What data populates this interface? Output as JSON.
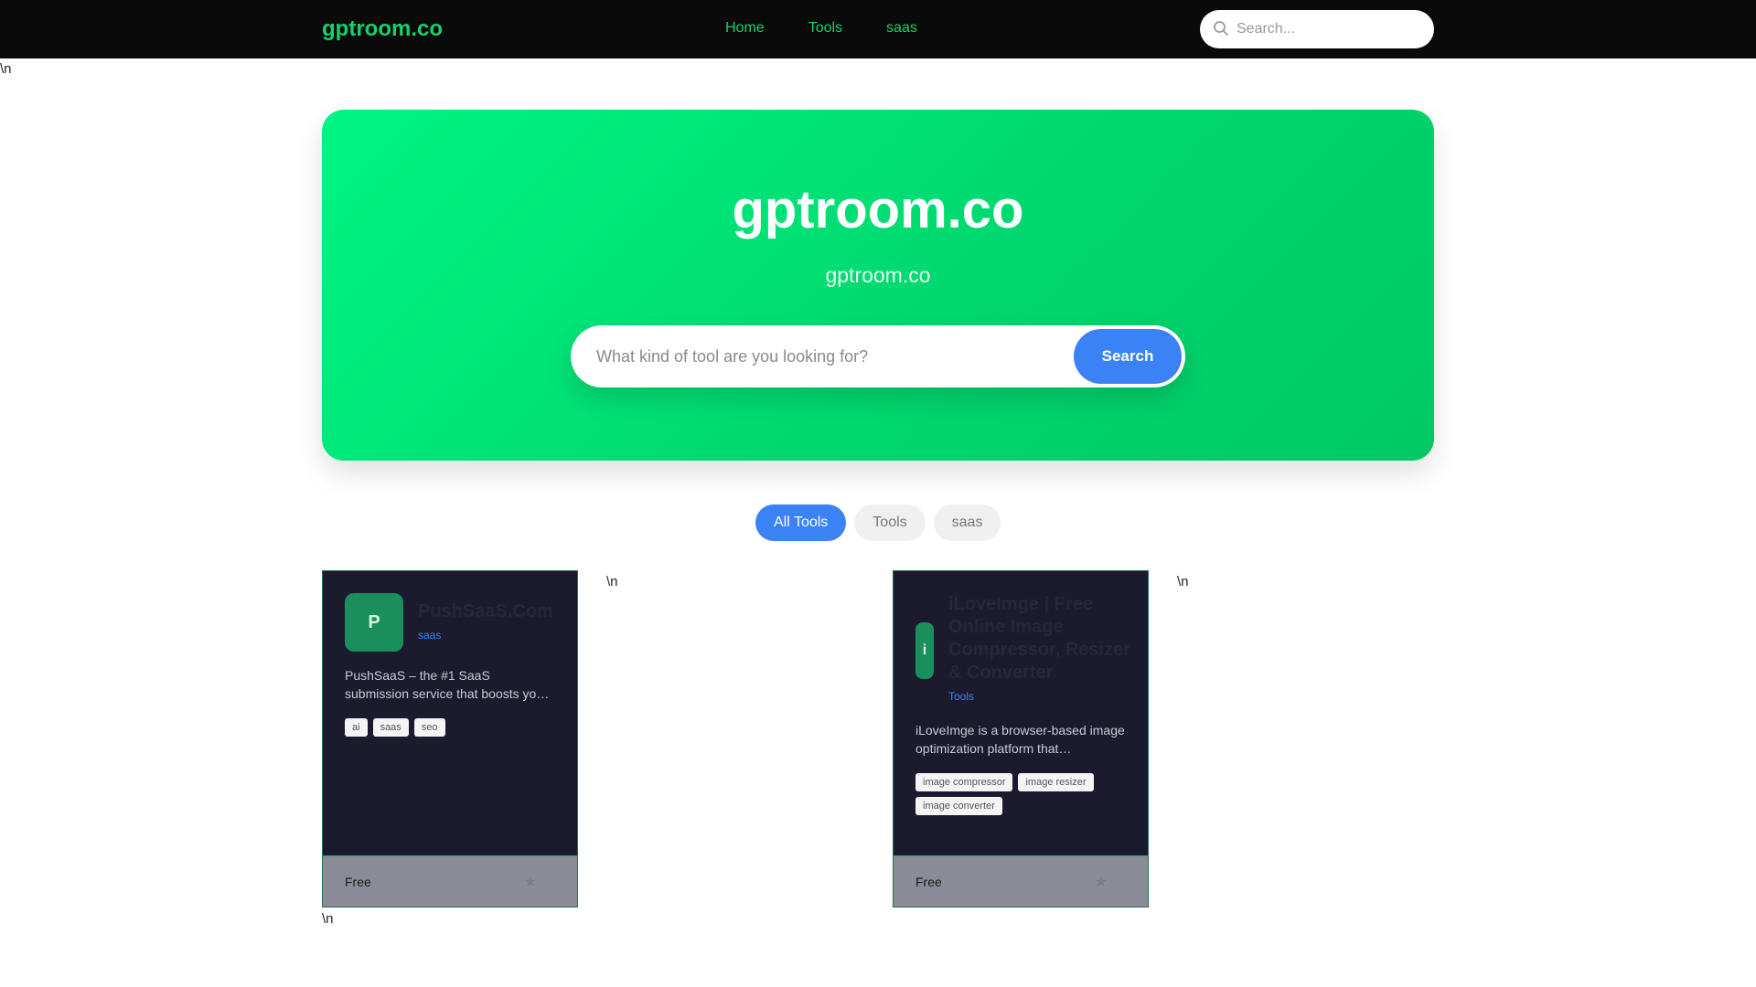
{
  "header": {
    "brand": "gptroom.co",
    "nav": [
      "Home",
      "Tools",
      "saas"
    ],
    "search_placeholder": "Search...",
    "search_icon": "search-icon"
  },
  "stray_text": "\\n",
  "hero": {
    "title": "gptroom.co",
    "subtitle": "gptroom.co",
    "search_placeholder": "What kind of tool are you looking for?",
    "search_button": "Search"
  },
  "filters": [
    "All Tools",
    "Tools",
    "saas"
  ],
  "cards": [
    {
      "avatar": "P",
      "title": "PushSaaS.Com",
      "category": "saas",
      "description": "PushSaaS – the #1 SaaS submission service that boosts yo…",
      "tags": [
        "ai",
        "saas",
        "seo"
      ],
      "price": "Free",
      "star_icon": "star-icon"
    },
    {
      "avatar": "i",
      "title": "iLoveImge | Free Online Image Compressor, Resizer & Converter",
      "category": "Tools",
      "description": "iLoveImge is a browser-based image optimization platform that…",
      "tags": [
        "image compressor",
        "image resizer",
        "image converter"
      ],
      "price": "Free",
      "star_icon": "star-icon"
    }
  ],
  "colors": {
    "brand_green": "#16d06a",
    "hero_gradient_start": "#00f584",
    "hero_gradient_end": "#00c865",
    "accent_blue": "#3b82f6",
    "card_bg": "#1c1b2e",
    "topbar_bg": "#0a0a0a"
  }
}
